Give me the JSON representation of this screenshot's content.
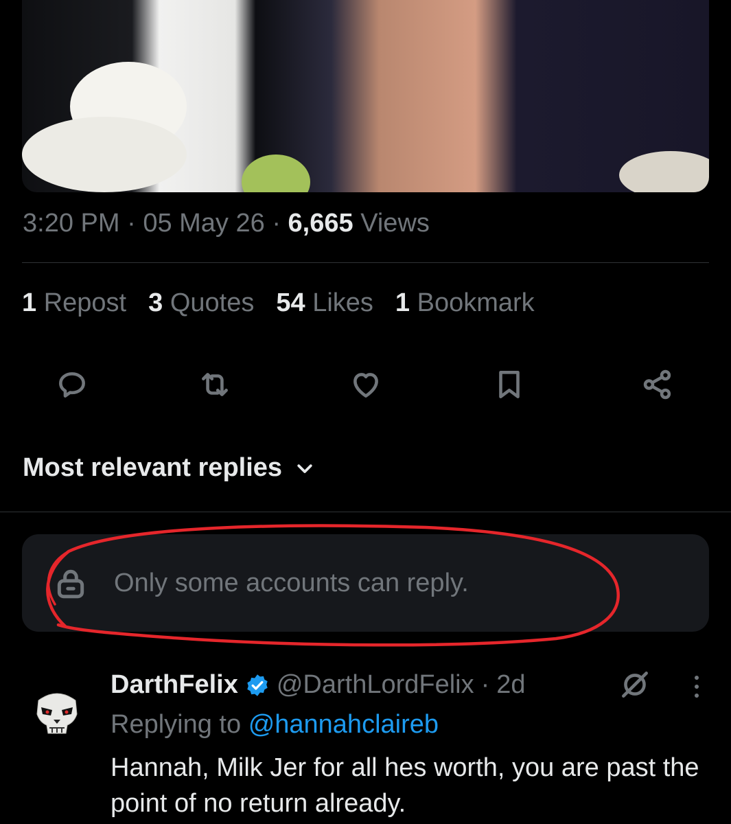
{
  "tweet": {
    "time": "3:20 PM",
    "date": "05 May 26",
    "views_count": "6,665",
    "views_label": "Views",
    "separator": "·"
  },
  "stats": {
    "reposts_count": "1",
    "reposts_label": "Repost",
    "quotes_count": "3",
    "quotes_label": "Quotes",
    "likes_count": "54",
    "likes_label": "Likes",
    "bookmarks_count": "1",
    "bookmarks_label": "Bookmark"
  },
  "actions": [
    "reply-icon",
    "repost-icon",
    "like-icon",
    "bookmark-icon",
    "share-icon"
  ],
  "sort": {
    "label": "Most relevant replies"
  },
  "reply_restriction": {
    "text": "Only some accounts can reply."
  },
  "reply": {
    "display_name": "DarthFelix",
    "handle": "@DarthLordFelix",
    "separator": "·",
    "time": "2d",
    "replying_prefix": "Replying to",
    "replying_to": "@hannahclaireb",
    "body": "Hannah, Milk Jer for all hes worth, you are past the point of no return already."
  },
  "colors": {
    "background": "#000000",
    "primary_text": "#e7e9ea",
    "secondary_text": "#71767b",
    "link": "#1d9bf0",
    "verified": "#1d9bf0",
    "annotation": "#e5262b"
  }
}
